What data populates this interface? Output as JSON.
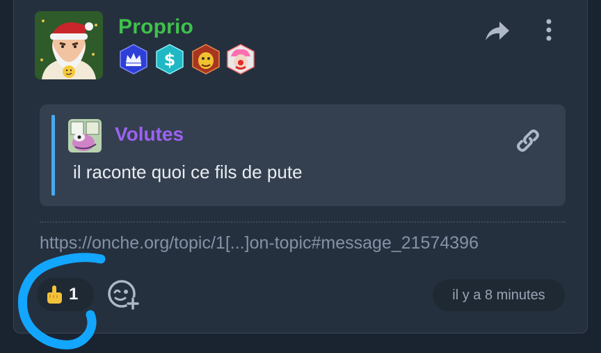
{
  "post": {
    "author": "Proprio",
    "author_color": "#3fc24a",
    "avatar_icon": "santa-avatar",
    "badges": [
      {
        "icon": "crown-badge-icon",
        "color": "#2d3fd6"
      },
      {
        "icon": "dollar-badge-icon",
        "color": "#1fb8c4"
      },
      {
        "icon": "cartoon-character-badge-icon",
        "color": "#c8502b"
      },
      {
        "icon": "clown-badge-icon",
        "color": "#d23a3a"
      }
    ],
    "actions": {
      "share_icon": "share-icon",
      "more_icon": "more-vertical-icon"
    }
  },
  "quote": {
    "author": "Volutes",
    "author_color": "#9d62f2",
    "avatar_icon": "cartoon-avatar",
    "text": "il raconte quoi ce fils de pute",
    "link_icon": "link-icon"
  },
  "url": "https://onche.org/topic/1[...]on-topic#message_21574396",
  "reactions": {
    "emoji_icon": "middle-finger-emoji-icon",
    "count": "1",
    "add_icon": "add-reaction-icon"
  },
  "timestamp": "il y a 8 minutes",
  "annotation": {
    "color": "#13a6ff"
  }
}
